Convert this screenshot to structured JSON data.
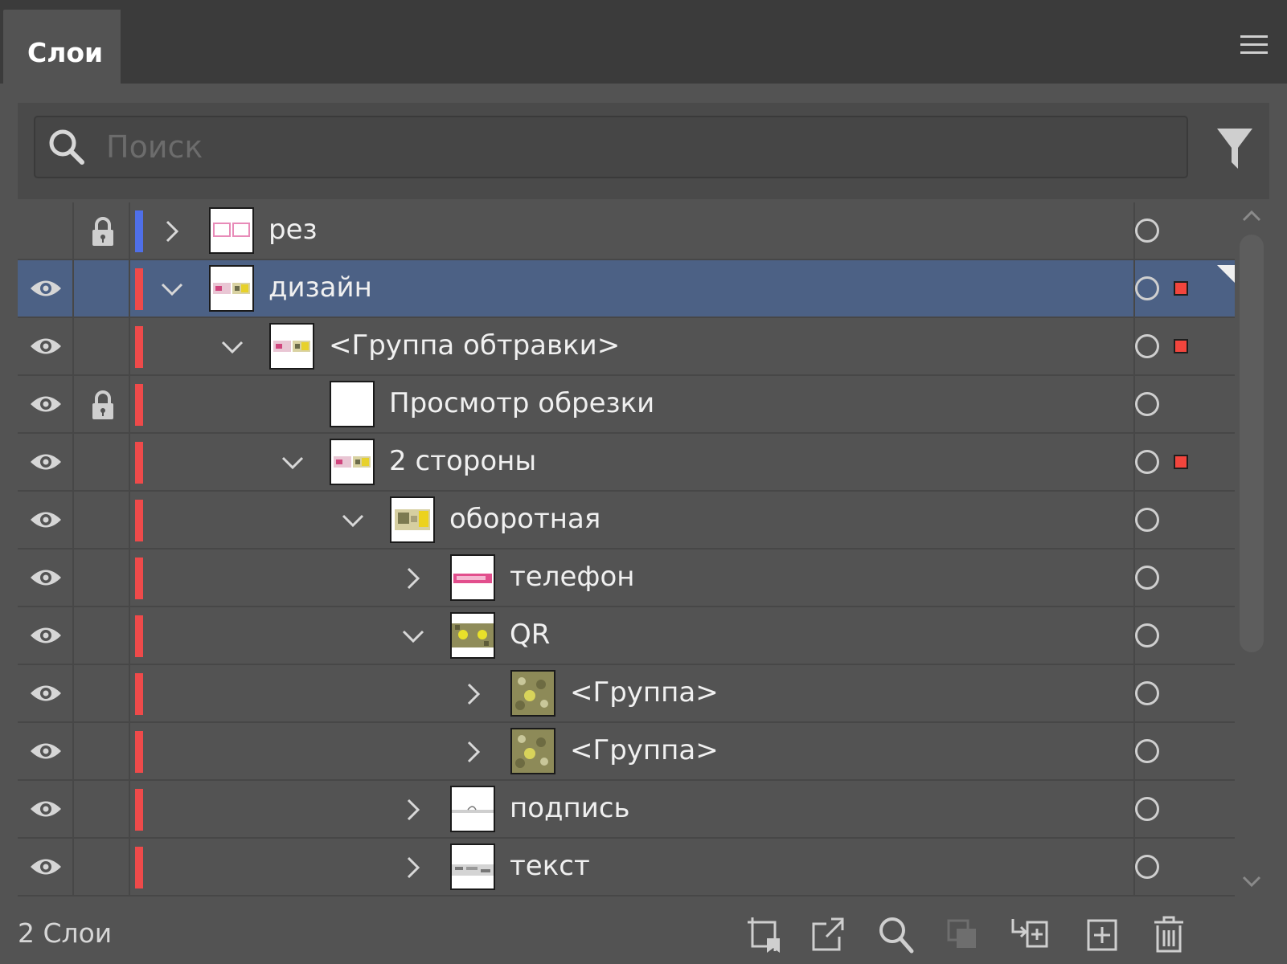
{
  "panel": {
    "tab_title": "Слои",
    "footer_count": "2 Слои"
  },
  "search": {
    "placeholder": "Поиск",
    "value": ""
  },
  "colors": {
    "selected_row": "#4c6185",
    "layer_blue": "#4f6fe8",
    "layer_red": "#ee4a4a",
    "selection_square": "#f2453d"
  },
  "layers": [
    {
      "name": "рез",
      "visible": false,
      "locked": true,
      "expanded": false,
      "depth": 0,
      "color": "blue",
      "selected": false,
      "has_selection": false,
      "thumb": "rez"
    },
    {
      "name": "дизайн",
      "visible": true,
      "locked": false,
      "expanded": true,
      "depth": 0,
      "color": "red",
      "selected": true,
      "has_selection": true,
      "thumb": "design"
    },
    {
      "name": "<Группа обтравки>",
      "visible": true,
      "locked": false,
      "expanded": true,
      "depth": 1,
      "color": "red",
      "selected": false,
      "has_selection": true,
      "thumb": "design"
    },
    {
      "name": "Просмотр обрезки",
      "visible": true,
      "locked": true,
      "expanded": null,
      "depth": 2,
      "color": "red",
      "selected": false,
      "has_selection": false,
      "thumb": "blank"
    },
    {
      "name": "2 стороны",
      "visible": true,
      "locked": false,
      "expanded": true,
      "depth": 2,
      "color": "red",
      "selected": false,
      "has_selection": true,
      "thumb": "design"
    },
    {
      "name": "оборотная",
      "visible": true,
      "locked": false,
      "expanded": true,
      "depth": 3,
      "color": "red",
      "selected": false,
      "has_selection": false,
      "thumb": "back"
    },
    {
      "name": "телефон",
      "visible": true,
      "locked": false,
      "expanded": false,
      "depth": 4,
      "color": "red",
      "selected": false,
      "has_selection": false,
      "thumb": "phone"
    },
    {
      "name": "QR",
      "visible": true,
      "locked": false,
      "expanded": true,
      "depth": 4,
      "color": "red",
      "selected": false,
      "has_selection": false,
      "thumb": "qr"
    },
    {
      "name": "<Группа>",
      "visible": true,
      "locked": false,
      "expanded": false,
      "depth": 5,
      "color": "red",
      "selected": false,
      "has_selection": false,
      "thumb": "qrgroup"
    },
    {
      "name": "<Группа>",
      "visible": true,
      "locked": false,
      "expanded": false,
      "depth": 5,
      "color": "red",
      "selected": false,
      "has_selection": false,
      "thumb": "qrgroup"
    },
    {
      "name": "подпись",
      "visible": true,
      "locked": false,
      "expanded": false,
      "depth": 4,
      "color": "red",
      "selected": false,
      "has_selection": false,
      "thumb": "sign"
    },
    {
      "name": "текст",
      "visible": true,
      "locked": false,
      "expanded": false,
      "depth": 4,
      "color": "red",
      "selected": false,
      "has_selection": false,
      "thumb": "text"
    }
  ],
  "footer_icons": [
    "artboard-icon",
    "export-icon",
    "locate-object-icon",
    "clipping-mask-icon",
    "new-sublayer-icon",
    "new-layer-icon",
    "trash-icon"
  ]
}
